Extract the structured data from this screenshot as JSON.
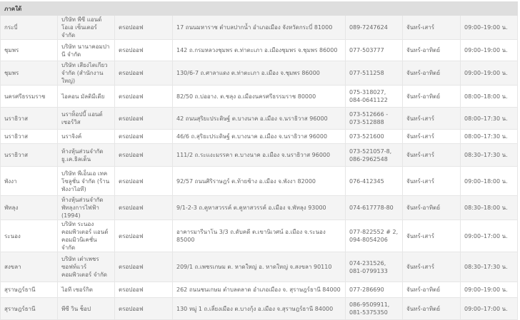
{
  "section_title": "ภาคใต้",
  "rows": [
    {
      "province": "กระบี่",
      "company": "บริษัท พีซี แอนด์ โอเอ เซ็นเตอร์ จำกัด",
      "type": "ตรอปออฟ",
      "address": "17 ถนนมหาราช ตำบลปากน้ำ อำเภอเมือง จังหวัดกระบี่ 81000",
      "phone": "089-7247624",
      "days": "จันทร์-เสาร์",
      "hours": "09:00–19:00 น."
    },
    {
      "province": "ชุมพร",
      "company": "บริษัท นานาคอมปานี จำกัด",
      "type": "ตรอปออฟ",
      "address": "142 ถ.กรมหลวงชุมพร ต.ท่าตะเภา อ.เมืองชุมพร จ.ชุมพร 86000",
      "phone": "077-503777",
      "days": "จันทร์-อาทิตย์",
      "hours": "09:00–19:00 น."
    },
    {
      "province": "ชุมพร",
      "company": "บริษัท เสียงไตเกียว จำกัด (สำนักงานใหญ่)",
      "type": "ตรอปออฟ",
      "address": "130/6-7 ถ.ศาลาแดง ต.ท่าตะเภา อ.เมือง จ.ชุมพร 86000",
      "phone": "077-511258",
      "days": "จันทร์-อาทิตย์",
      "hours": "09:00–19:00 น."
    },
    {
      "province": "นครศรีธรรมราช",
      "company": "ไอคอน มัลติมีเดีย",
      "type": "ตรอปออฟ",
      "address": "82/50 ถ.บ่ออาง. ต.ชลุง อ.เมืองนครศรีธรรมราช 80000",
      "phone": "075-318027, 084-0641122",
      "days": "จันทร์-อาทิตย์",
      "hours": "08:00–18:00 น."
    },
    {
      "province": "นราธิวาส",
      "company": "นราท็อปบี้ แอนด์ เซอร์วิส",
      "type": "ตรอปออฟ",
      "address": "42 ถนนสุริยะประดิษฐ์ ต.บางนาค อ.เมือง จ.นราธิวาส 96000",
      "phone": "073-512666 - 073-512888",
      "days": "จันทร์-เสาร์",
      "hours": "08:00–17:30 น."
    },
    {
      "province": "นราธิวาส",
      "company": "นราจิงค์",
      "type": "ตรอปออฟ",
      "address": "46/6 ถ.สุริยะประดิษฐ์ ต.บางนาค อ.เมือง จ.นราธิวาส 96000",
      "phone": "073-521600",
      "days": "จันทร์-เสาร์",
      "hours": "08:00–17:30 น."
    },
    {
      "province": "นราธิวาส",
      "company": "ห้างหุ้นส่วนจำกัด ยู.เค.ธิลเด็น",
      "type": "ตรอปออฟ",
      "address": "111/2 ถ.ระแงะมรรคา ต.บางนาค อ.เมือง จ.นราธิวาส 96000",
      "phone": "073-521057-8, 086-2962548",
      "days": "จันทร์-เสาร์",
      "hours": "08:30–17:30 น."
    },
    {
      "province": "พังงา",
      "company": "บริษัท พีเอ็นเอ เทค โซลูชั่น จำกัด (ร้านพังงาไอที)",
      "type": "ตรอปออฟ",
      "address": "92/57 ถนนศิริราษฎร์ ต.ท้ายช้าง อ.เมือง จ.พังงา 82000",
      "phone": "076-412345",
      "days": "จันทร์-เสาร์",
      "hours": "09:00–18:00 น."
    },
    {
      "province": "พัทลุง",
      "company": "ห้างหุ้นส่วนจำกัด พัทลุงการไฟฟ้า (1994)",
      "type": "ตรอปออฟ",
      "address": "9/1-2-3 ถ.คูหาสวรรค์ ต.คูหาสวรรค์ อ.เมือง จ.พัทลุง 93000",
      "phone": "074-617778-80",
      "days": "จันทร์-อาทิตย์",
      "hours": "08:30–18:00 น."
    },
    {
      "province": "ระนอง",
      "company": "บริษัท ระนอง คอมพิวเตอร์ แอนด์ คอมมิวนิเคชั่น จำกัด",
      "type": "ตรอปออฟ",
      "address": "อาคารมารีนาโน 3/3 ถ.ดับคดี ต.เขานิเวศน์ อ.เมือง จ.ระนอง 85000",
      "phone": "077-822552 # 2, 094-8054206",
      "days": "จันทร์-เสาร์",
      "hours": "09:00–17:00 น."
    },
    {
      "province": "สงขลา",
      "company": "บริษัท เต๋าเพชร ซอฟท์แวร์ คอมพิวเตอร์ จำกัด",
      "type": "ตรอปออฟ",
      "address": "209/1 ถ.เพชรเกษม ต. หาดใหญ่ อ. หาดใหญ่ จ.สงขลา 90110",
      "phone": "074-231526, 081-0799133",
      "days": "จันทร์-เสาร์",
      "hours": "08:30–17:30 น."
    },
    {
      "province": "สุราษฎร์ธานี",
      "company": "ไอที เซอร์กิต",
      "type": "ตรอปออฟ",
      "address": "262 ถนนชนเกษม ตำบลตลาด อำเภอเมือง จ. สุราษฎร์ธานี 84000",
      "phone": "077-286690",
      "days": "จันทร์-อาทิตย์",
      "hours": "09:00–19:00 น."
    },
    {
      "province": "สุราษฎร์ธานี",
      "company": "พีซี วิน ช็อป",
      "type": "ตรอปออฟ",
      "address": "130 หมู่ 1 ถ.เลี่ยงเมือง ต.บางกุ้ง อ.เมือง จ.สุราษฎร์ธานี 84000",
      "phone": "086-9509911, 081-5375350",
      "days": "จันทร์-อาทิตย์",
      "hours": "09:00–17:00 น."
    }
  ]
}
